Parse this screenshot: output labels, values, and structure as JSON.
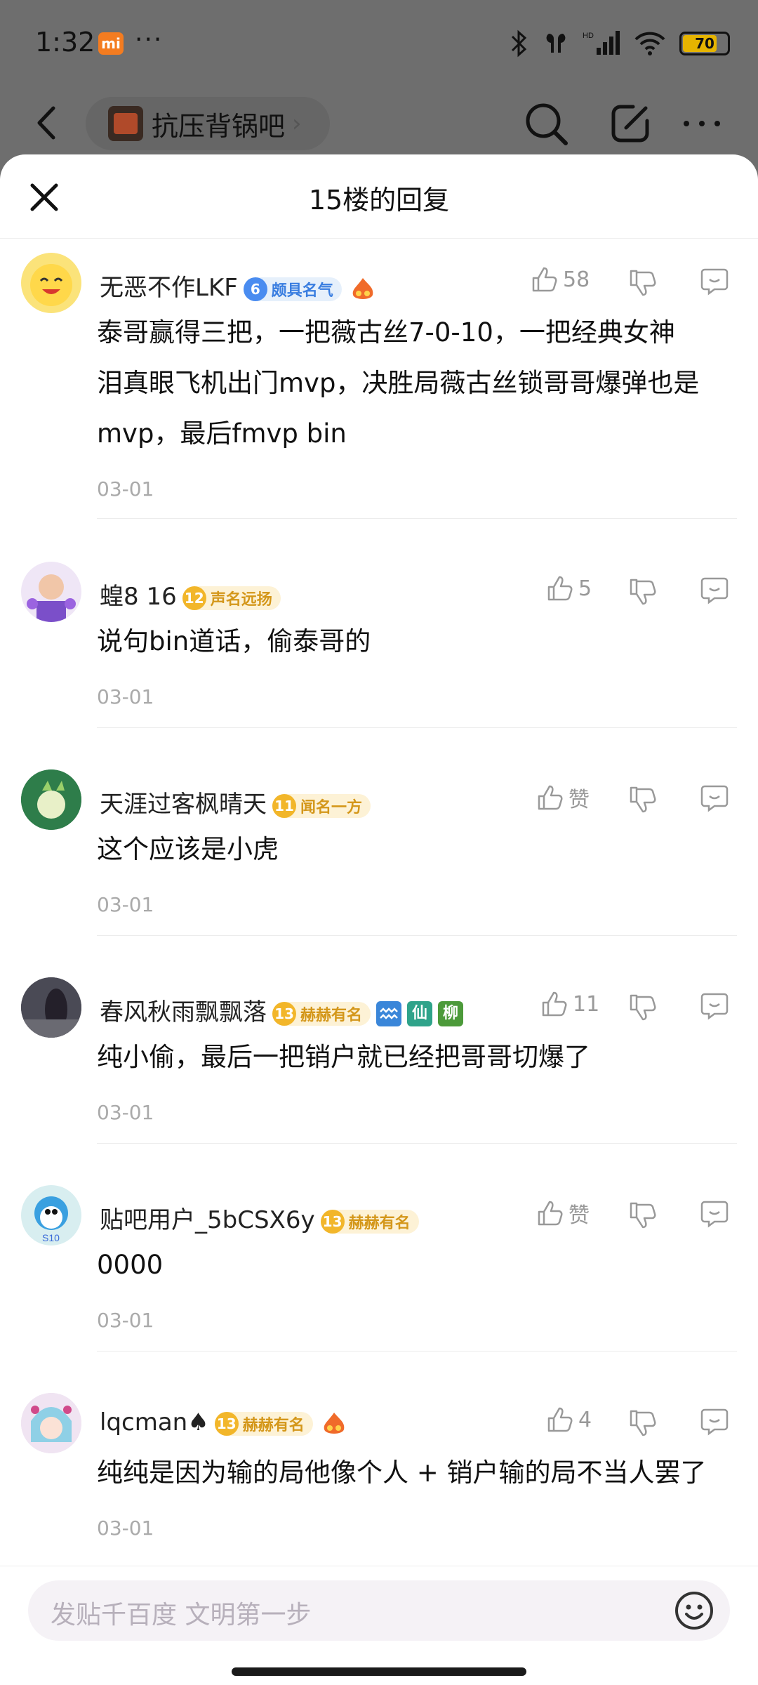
{
  "status_bar": {
    "time": "1:32",
    "mi_badge": "mi",
    "dots": "···",
    "battery": "70"
  },
  "nav": {
    "forum_name": "抗压背锅吧",
    "chevron": "›"
  },
  "sheet": {
    "title": "15楼的回复"
  },
  "comments": [
    {
      "user": "无恶不作LKF",
      "level": "6",
      "title": "颇具名气",
      "level_style": "blue",
      "likes": "58",
      "lines": [
        "泰哥赢得三把，一把薇古丝7-0-10，一把经典女神",
        "泪真眼飞机出门mvp，决胜局薇古丝锁哥哥爆弹也是",
        "mvp，最后fmvp bin"
      ],
      "date": "03-01"
    },
    {
      "user": "蝗8 16",
      "level": "12",
      "title": "声名远扬",
      "level_style": "gold",
      "likes": "5",
      "lines": [
        "说句bin道话，偷泰哥的"
      ],
      "date": "03-01"
    },
    {
      "user": "天涯过客枫晴天",
      "level": "11",
      "title": "闻名一方",
      "level_style": "gold",
      "likes": "赞",
      "lines": [
        "这个应该是小虎"
      ],
      "date": "03-01"
    },
    {
      "user": "春风秋雨飘飘落",
      "level": "13",
      "title": "赫赫有名",
      "level_style": "gold",
      "likes": "11",
      "badges": [
        "仙",
        "柳"
      ],
      "lines": [
        "纯小偷，最后一把销户就已经把哥哥切爆了"
      ],
      "date": "03-01"
    },
    {
      "user": "贴吧用户_5bCSX6y",
      "level": "13",
      "title": "赫赫有名",
      "level_style": "gold",
      "likes": "赞",
      "lines": [
        "0000"
      ],
      "date": "03-01"
    },
    {
      "user": "lqcman♠",
      "level": "13",
      "title": "赫赫有名",
      "level_style": "gold",
      "likes": "4",
      "lines": [
        "纯纯是因为输的局他像个人 + 销户输的局不当人罢了"
      ],
      "date": "03-01"
    }
  ],
  "input": {
    "placeholder": "发贴千百度 文明第一步"
  },
  "colors": {
    "accent_blue": "#4a8cf0",
    "accent_gold": "#f2b62a",
    "dim_overlay": "#6e6e6e"
  },
  "icons": [
    "back-icon",
    "search-icon",
    "edit-icon",
    "more-icon",
    "close-icon",
    "thumb-up-icon",
    "thumb-down-icon",
    "reply-bubble-icon",
    "emoji-icon"
  ]
}
